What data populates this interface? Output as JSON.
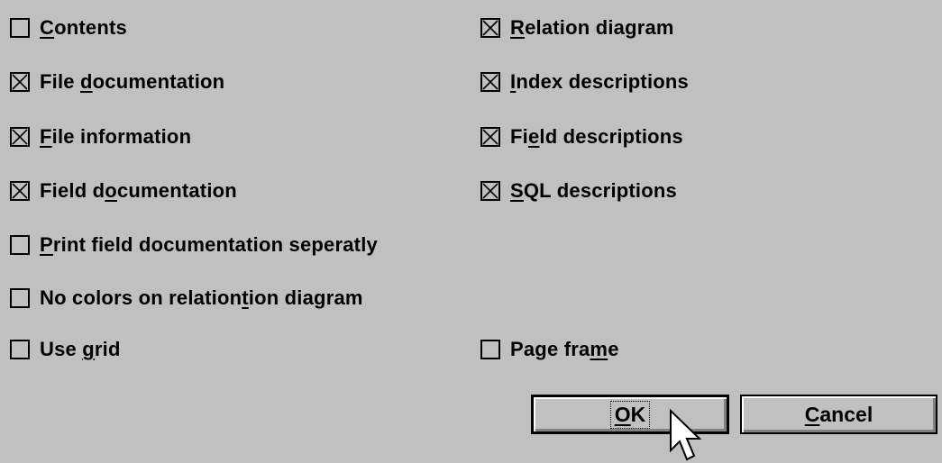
{
  "colors": {
    "dialog_background": "#c0c0c0",
    "text": "#000000",
    "button_highlight": "#ffffff",
    "button_shadow": "#808080"
  },
  "options_left": [
    {
      "name": "contents",
      "pre": "",
      "key": "C",
      "post": "ontents",
      "checked": false
    },
    {
      "name": "file-documentation",
      "pre": "File ",
      "key": "d",
      "post": "ocumentation",
      "checked": true
    },
    {
      "name": "file-information",
      "pre": "",
      "key": "F",
      "post": "ile information",
      "checked": true
    },
    {
      "name": "field-documentation",
      "pre": "Field d",
      "key": "o",
      "post": "cumentation",
      "checked": true
    },
    {
      "name": "print-field-documentation-seperatly",
      "pre": "",
      "key": "P",
      "post": "rint field documentation seperatly",
      "checked": false
    },
    {
      "name": "no-colors-on-relationtion-diagram",
      "pre": "No colors on relation",
      "key": "t",
      "post": "ion diagram",
      "checked": false
    },
    {
      "name": "use-grid",
      "pre": "Use ",
      "key": "g",
      "post": "rid",
      "checked": false
    }
  ],
  "options_right": [
    {
      "name": "relation-diagram",
      "pre": "",
      "key": "R",
      "post": "elation diagram",
      "checked": true
    },
    {
      "name": "index-descriptions",
      "pre": "",
      "key": "I",
      "post": "ndex descriptions",
      "checked": true
    },
    {
      "name": "field-descriptions",
      "pre": "Fi",
      "key": "e",
      "post": "ld descriptions",
      "checked": true
    },
    {
      "name": "sql-descriptions",
      "pre": "",
      "key": "S",
      "post": "QL descriptions",
      "checked": true
    },
    {
      "name": "page-frame",
      "pre": "Page fra",
      "key": "m",
      "post": "e",
      "checked": false
    }
  ],
  "buttons": {
    "ok": {
      "pre": "",
      "key": "O",
      "post": "K"
    },
    "cancel": {
      "pre": "",
      "key": "C",
      "post": "ancel"
    }
  },
  "cursor_icon": "arrow-cursor-icon"
}
